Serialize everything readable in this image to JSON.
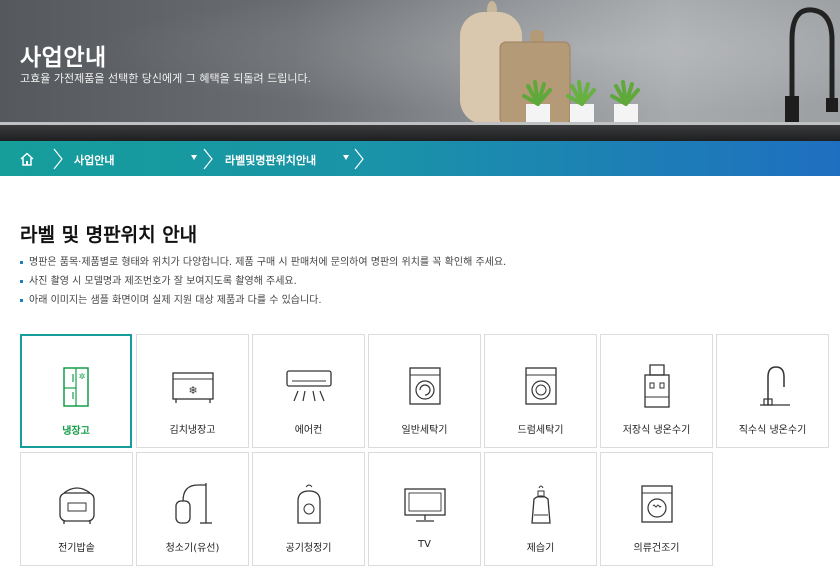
{
  "hero": {
    "title": "사업안내",
    "subtitle": "고효율 가전제품을 선택한 당신에게 그 혜택을 되돌려 드립니다."
  },
  "breadcrumb": {
    "home_icon": "home-icon",
    "items": [
      "사업안내",
      "라벨및명판위치안내"
    ]
  },
  "main": {
    "heading": "라벨 및 명판위치 안내",
    "notes": [
      "명판은 품목·제품별로 형태와 위치가 다양합니다. 제품 구매 시 판매처에 문의하여 명판의 위치를 꼭 확인해 주세요.",
      "사진 촬영 시 모델명과 제조번호가 잘 보여지도록 촬영해 주세요.",
      "아래 이미지는 샘플 화면이며 실제 지원 대상 제품과 다를 수 있습니다."
    ],
    "products": [
      {
        "label": "냉장고",
        "icon": "refrigerator-icon",
        "selected": true
      },
      {
        "label": "김치냉장고",
        "icon": "kimchi-refrigerator-icon"
      },
      {
        "label": "에어컨",
        "icon": "air-conditioner-icon"
      },
      {
        "label": "일반세탁기",
        "icon": "washing-machine-icon"
      },
      {
        "label": "드럼세탁기",
        "icon": "drum-washer-icon"
      },
      {
        "label": "저장식 냉온수기",
        "icon": "water-dispenser-icon"
      },
      {
        "label": "직수식 냉온수기",
        "icon": "faucet-icon"
      },
      {
        "label": "전기밥솥",
        "icon": "rice-cooker-icon"
      },
      {
        "label": "청소기(유선)",
        "icon": "vacuum-cleaner-icon"
      },
      {
        "label": "공기청정기",
        "icon": "air-purifier-icon"
      },
      {
        "label": "TV",
        "icon": "tv-icon"
      },
      {
        "label": "제습기",
        "icon": "dehumidifier-icon"
      },
      {
        "label": "의류건조기",
        "icon": "clothes-dryer-icon"
      }
    ]
  },
  "colors": {
    "accent_teal": "#159e9a",
    "accent_blue": "#1f6fc0",
    "selected_label": "#159e4a"
  }
}
